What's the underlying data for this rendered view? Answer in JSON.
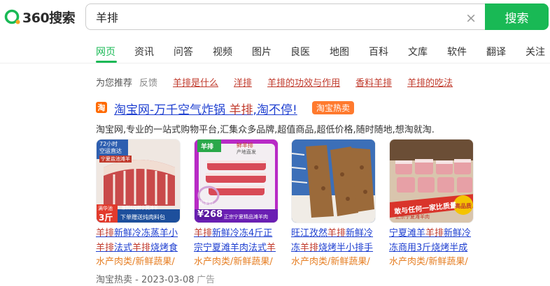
{
  "header": {
    "logo_text": "360搜索",
    "query": "羊排",
    "clear_symbol": "×",
    "search_button": "搜索"
  },
  "tabs": [
    "网页",
    "资讯",
    "问答",
    "视频",
    "图片",
    "良医",
    "地图",
    "百科",
    "文库",
    "软件",
    "翻译",
    "关注"
  ],
  "recommend": {
    "label": "为您推荐",
    "feedback": "反馈",
    "links": [
      "羊排是什么",
      "洋排",
      "羊排的功效与作用",
      "香料羊排",
      "羊排的吃法"
    ]
  },
  "result": {
    "icon_text": "淘",
    "title_pre": "淘宝网-万千空气炸锅 ",
    "title_em": "羊排",
    "title_post": ",淘不停!",
    "badge": "淘宝热卖",
    "desc": "淘宝网,专业的一站式购物平台,汇集众多品牌,超值商品,超低价格,随时随地,想淘就淘.",
    "footer": "淘宝热卖 - 2023-03-08",
    "ad": "广告"
  },
  "products": [
    {
      "title_html": [
        "羊排",
        "新鲜冷冻蒸羊小",
        "羊排",
        "法式",
        "羊排",
        "烧烤食"
      ],
      "category": "水产肉类/新鲜蔬果/",
      "img_texts": [
        "72小时",
        "空运直达",
        "宁夏盐池滩羊",
        "满华池",
        "3斤",
        "下单赠送炖肉料包",
        "原料6月龄宁夏滩羊"
      ]
    },
    {
      "title_html": [
        "羊排",
        "新鲜冷冻4斤正",
        "宗宁夏滩羊肉法式",
        "羊"
      ],
      "category": "水产肉类/新鲜蔬果/",
      "img_texts": [
        "羊排",
        "到手价",
        "¥268",
        "正宗宁夏精品滩羊肉",
        "鲜羊排",
        "产地直发"
      ]
    },
    {
      "title_html": [
        "旺江孜然",
        "羊排",
        "新鲜冷",
        "冻",
        "羊排",
        "烧烤半小排手"
      ],
      "category": "水产肉类/新鲜蔬果/",
      "img_texts": []
    },
    {
      "title_html": [
        "宁夏滩羊",
        "羊排",
        "新鲜冷",
        "冻商用3斤烧烤半成"
      ],
      "category": "水产肉类/新鲜蔬果/",
      "img_texts": [
        "敢与任何一家比质量",
        "正宗宁夏滩羊肉",
        "高品质"
      ]
    }
  ],
  "colors": {
    "brand_green": "#19b955",
    "link_blue": "#1e3fd0",
    "highlight_red": "#c0392b",
    "category_orange": "#e67e22",
    "badge_orange": "#ff7a2e"
  }
}
